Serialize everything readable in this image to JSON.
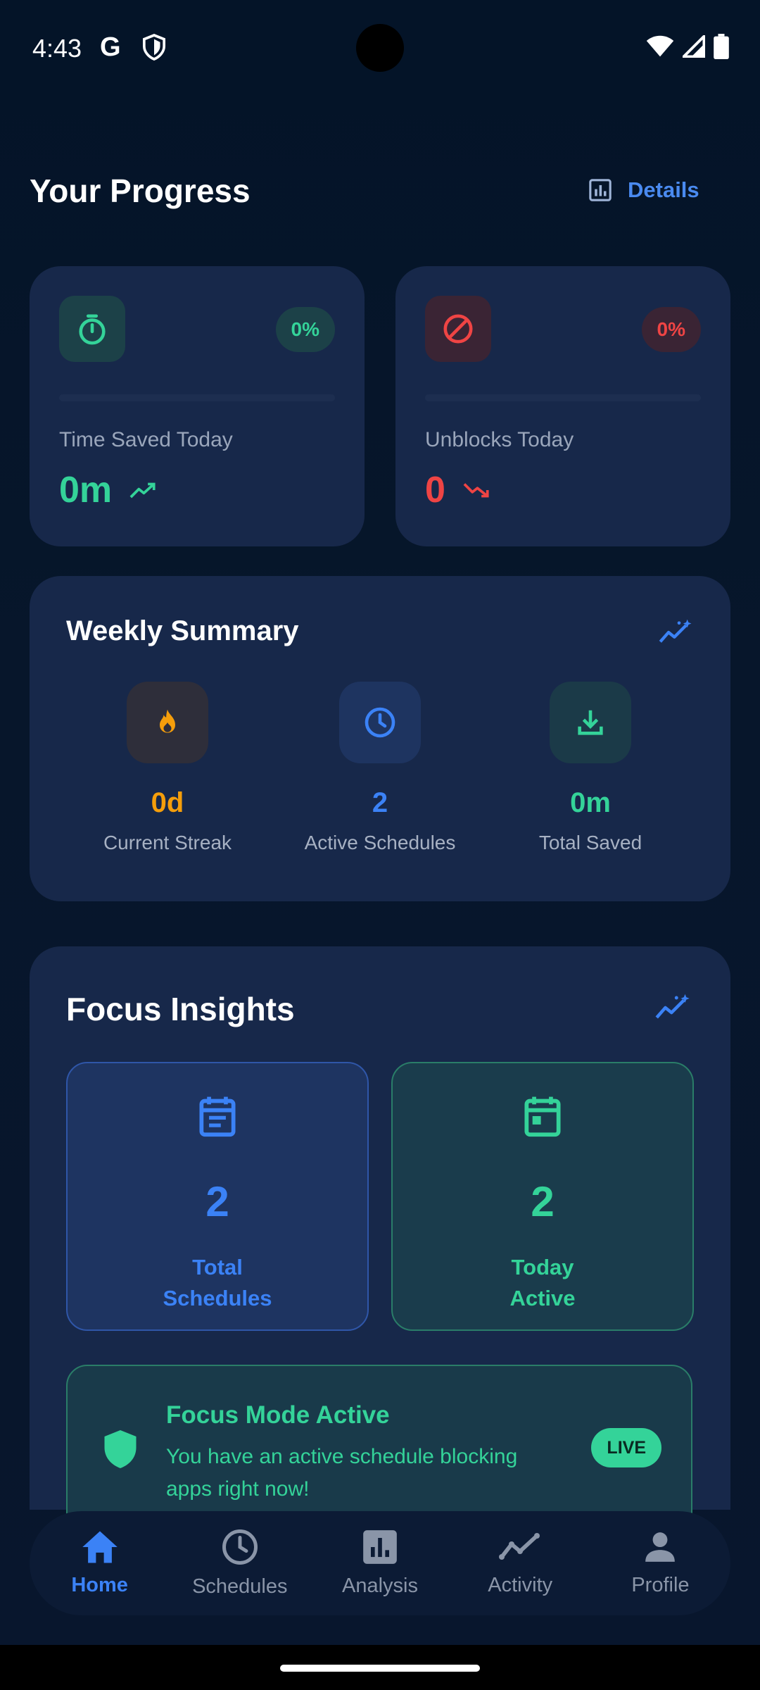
{
  "status_bar": {
    "time": "4:43",
    "g_logo": "G"
  },
  "header": {
    "title": "Your Progress",
    "details_label": "Details"
  },
  "stats": [
    {
      "id": "time_saved",
      "label": "Time Saved Today",
      "value": "0m",
      "percent": "0%",
      "color": "#34d399",
      "icon": "timer-icon",
      "trend": "trending-up-icon",
      "progress": 0
    },
    {
      "id": "unblocks",
      "label": "Unblocks Today",
      "value": "0",
      "percent": "0%",
      "color": "#ef4444",
      "icon": "block-icon",
      "trend": "trending-down-icon",
      "progress": 0
    }
  ],
  "weekly_summary": {
    "title": "Weekly Summary",
    "items": [
      {
        "value": "0d",
        "label": "Current Streak",
        "color": "#f59e0b",
        "icon": "fire-icon"
      },
      {
        "value": "2",
        "label": "Active Schedules",
        "color": "#3b82f6",
        "icon": "clock-icon"
      },
      {
        "value": "0m",
        "label": "Total Saved",
        "color": "#34d399",
        "icon": "download-icon"
      }
    ]
  },
  "focus_insights": {
    "title": "Focus Insights",
    "total_schedules": {
      "value": "2",
      "label_line1": "Total",
      "label_line2": "Schedules"
    },
    "today_active": {
      "value": "2",
      "label_line1": "Today",
      "label_line2": "Active"
    },
    "banner": {
      "title": "Focus Mode Active",
      "description": "You have an active schedule blocking apps right now!",
      "badge": "LIVE"
    }
  },
  "nav": {
    "items": [
      {
        "label": "Home",
        "icon": "home-icon",
        "active": true
      },
      {
        "label": "Schedules",
        "icon": "clock-icon",
        "active": false
      },
      {
        "label": "Analysis",
        "icon": "bar-chart-icon",
        "active": false
      },
      {
        "label": "Activity",
        "icon": "activity-line-icon",
        "active": false
      },
      {
        "label": "Profile",
        "icon": "person-icon",
        "active": false
      }
    ]
  },
  "colors": {
    "accent": "#3b82f6",
    "green": "#34d399",
    "red": "#ef4444",
    "orange": "#f59e0b",
    "card": "#17284a"
  }
}
